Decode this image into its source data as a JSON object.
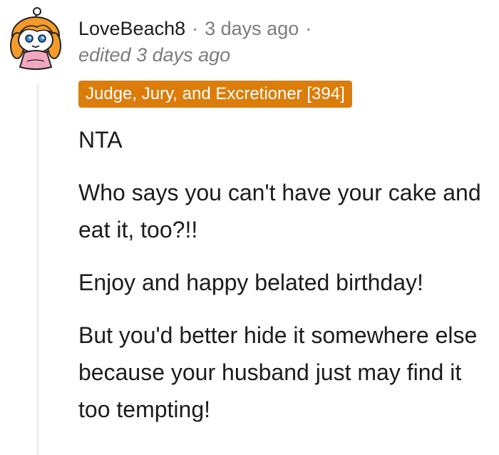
{
  "comment": {
    "username": "LoveBeach8",
    "separator": "·",
    "timestamp": "3 days ago",
    "edited": "edited 3 days ago",
    "flair": {
      "text": "Judge, Jury, and Excretioner [394]",
      "color": "#dc7d0a"
    },
    "paragraphs": [
      "NTA",
      "Who says you can't have your cake and eat it, too?!!",
      "Enjoy and happy belated birthday!",
      "But you'd better hide it somewhere else because your husband just may find it too tempting!"
    ],
    "avatar_icon": "snoo-avatar-icon"
  },
  "colors": {
    "text": "#1c1c1c",
    "muted": "#7c7c7c",
    "thread_line": "#e6e8ea"
  }
}
